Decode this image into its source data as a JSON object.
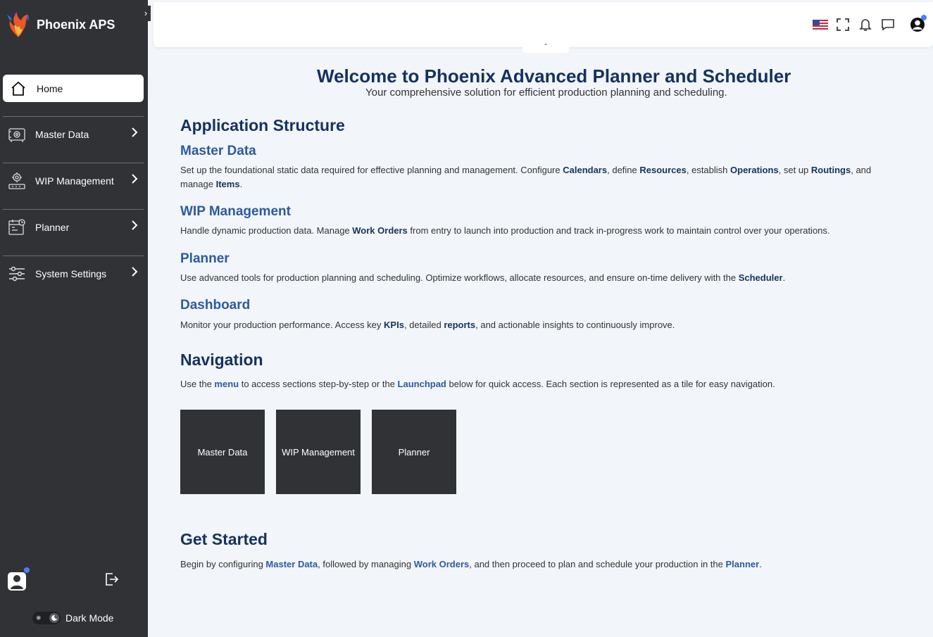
{
  "app": {
    "name": "Phoenix APS"
  },
  "sidebar": {
    "collapse_glyph": "›",
    "items": [
      {
        "label": "Home",
        "icon": "home-icon"
      },
      {
        "label": "Master Data",
        "icon": "master-data-icon"
      },
      {
        "label": "WIP Management",
        "icon": "wip-management-icon"
      },
      {
        "label": "Planner",
        "icon": "planner-icon"
      },
      {
        "label": "System Settings",
        "icon": "system-settings-icon"
      }
    ],
    "dark_mode_label": "Dark Mode"
  },
  "header": {
    "collapse_glyph": "ˆ"
  },
  "page": {
    "title": "Welcome to Phoenix Advanced Planner and Scheduler",
    "subtitle": "Your comprehensive solution for efficient production planning and scheduling.",
    "structure": {
      "heading": "Application Structure",
      "master_data": {
        "heading": "Master Data",
        "t1": "Set up the foundational static data required for effective planning and management. Configure ",
        "k1": "Calendars",
        "t2": ", define ",
        "k2": "Resources",
        "t3": ", establish ",
        "k3": "Operations",
        "t4": ", set up ",
        "k4": "Routings",
        "t5": ", and manage ",
        "k5": "Items",
        "t6": "."
      },
      "wip": {
        "heading": "WIP Management",
        "t1": "Handle dynamic production data. Manage ",
        "k1": "Work Orders",
        "t2": " from entry to launch into production and track in-progress work to maintain control over your operations."
      },
      "planner": {
        "heading": "Planner",
        "t1": "Use advanced tools for production planning and scheduling. Optimize workflows, allocate resources, and ensure on-time delivery with the ",
        "k1": "Scheduler",
        "t2": "."
      },
      "dashboard": {
        "heading": "Dashboard",
        "t1": "Monitor your production performance. Access key ",
        "k1": "KPIs",
        "t2": ", detailed ",
        "k2": "reports",
        "t3": ", and actionable insights to continuously improve."
      }
    },
    "navigation": {
      "heading": "Navigation",
      "t1": "Use the ",
      "l1": "menu",
      "t2": " to access sections step-by-step or the ",
      "l2": "Launchpad",
      "t3": " below for quick access. Each section is represented as a tile for easy navigation.",
      "tiles": [
        "Master Data",
        "WIP Management",
        "Planner"
      ]
    },
    "get_started": {
      "heading": "Get Started",
      "t1": "Begin by configuring ",
      "l1": "Master Data",
      "t2": ", followed by managing ",
      "l2": "Work Orders",
      "t3": ", and then proceed to plan and schedule your production in the ",
      "l3": "Planner",
      "t4": "."
    }
  },
  "colors": {
    "sidebar_bg": "#303236",
    "heading": "#15325e",
    "link": "#2d5aa0",
    "page_bg": "#f2f5f9",
    "notification_dot": "#4e7dff"
  }
}
